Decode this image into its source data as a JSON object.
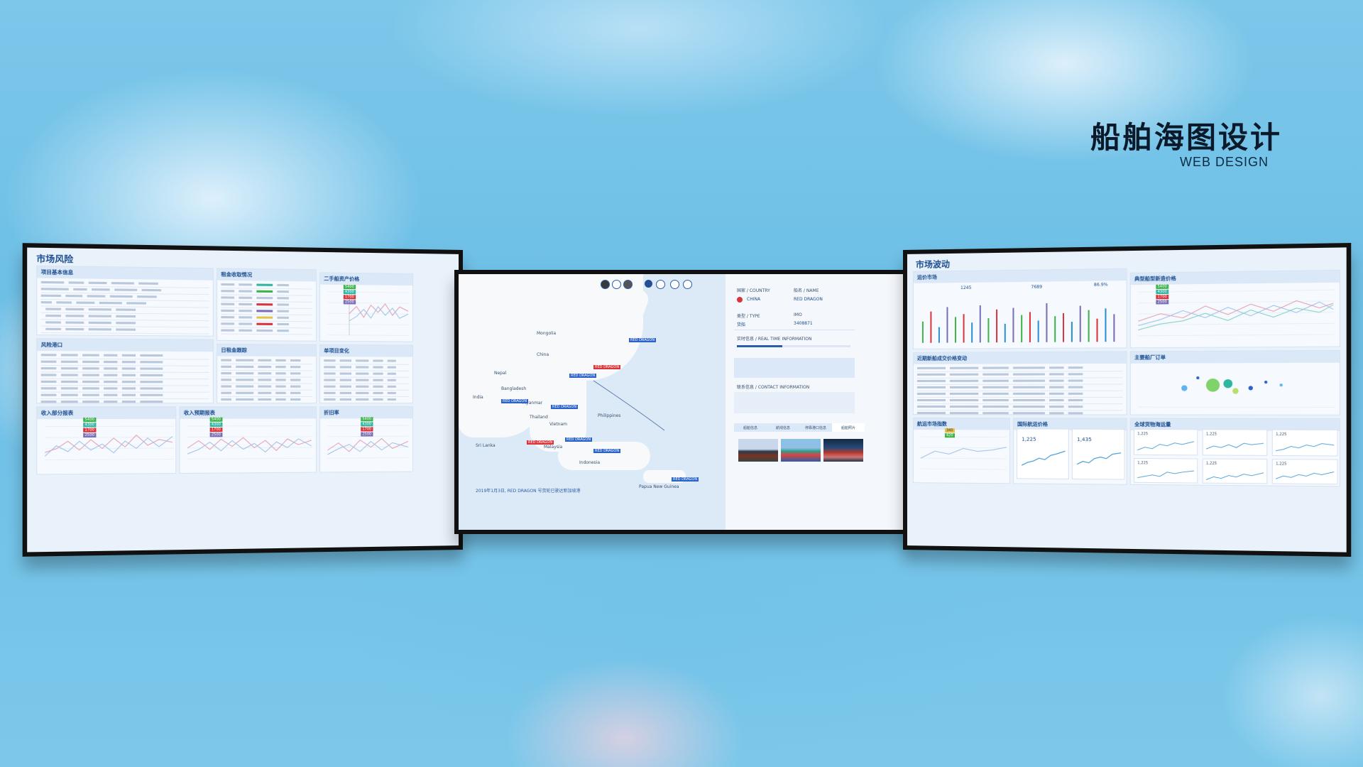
{
  "brand": {
    "title_zh": "船舶海图设计",
    "title_en": "WEB DESIGN"
  },
  "left_screen": {
    "title": "市场风险",
    "panels": {
      "basic_info": "项目基本信息",
      "ship_status": "租金收取情况",
      "secondhand_price": "二手船资产价格",
      "risk_port": "风险港口",
      "daily_charter": "日租金跟踪",
      "project_change": "单项目变化",
      "income_share": "收入部分报表",
      "income_forecast": "收入预期报表",
      "return_rate": "折旧率"
    },
    "legend_tags": [
      "5400",
      "4300",
      "1700",
      "2500"
    ],
    "legend_colors": [
      "#3fb24a",
      "#2fb6a1",
      "#d9343a",
      "#7a6fb5"
    ]
  },
  "center_screen": {
    "tool_icons": [
      "ship-icon",
      "globe-icon",
      "world-icon",
      "layers-icon",
      "settings-icon",
      "link-icon",
      "info-icon"
    ],
    "map_labels": [
      "Mongolia",
      "China",
      "Nepal",
      "Bangladesh",
      "India",
      "Myanmar",
      "Thailand",
      "Vietnam",
      "Philippines",
      "Malaysia",
      "Indonesia",
      "Papua New Guinea",
      "Sri Lanka"
    ],
    "vessel_tags": [
      "RED DRAGON",
      "RED DRAGON",
      "RED DRAGON",
      "RED DRAGON",
      "RED DRAGON",
      "RED DRAGON",
      "RED DRAGON"
    ],
    "alert_tags": [
      "RED DRAGON",
      "RED DRAGON"
    ],
    "caption": "2019年1月3日, RED DRAGON 号货轮已驶达新加坡港",
    "detail": {
      "country_label": "国家 / COUNTRY",
      "country_value": "CHINA",
      "name_label": "船名 / NAME",
      "name_value": "RED DRAGON",
      "type_label": "类型 / TYPE",
      "type_value": "货船",
      "imo_label": "IMO",
      "imo_value": "3408871",
      "realtime_label": "实时信息 / REAL TIME INFORMATION",
      "contact_label": "联系信息 / CONTACT INFORMATION",
      "tabs": [
        "船舶信息",
        "航线信息",
        "停靠港口信息",
        "船舶照片"
      ]
    }
  },
  "right_screen": {
    "title": "市场波动",
    "panels": {
      "freight_market": "运价市场",
      "ship_price": "典型船型新造价格",
      "recent_change": "近期新船成交价格变动",
      "main_orders": "主要船厂订单",
      "cargo_market": "航运市场指数",
      "intl_price": "国际航运价格",
      "global_shipping": "全球货物海运量"
    },
    "stats": {
      "a": "1245",
      "b": "7689",
      "c": "86.9%"
    },
    "mini_values": [
      "1,225",
      "1,435"
    ],
    "grid_values": [
      "1,225",
      "1,225",
      "1,225",
      "1,225",
      "1,225",
      "1,225"
    ],
    "legend_tags": [
      "5400",
      "4300",
      "1700",
      "2500"
    ],
    "small_tags": [
      "340",
      "420"
    ]
  }
}
